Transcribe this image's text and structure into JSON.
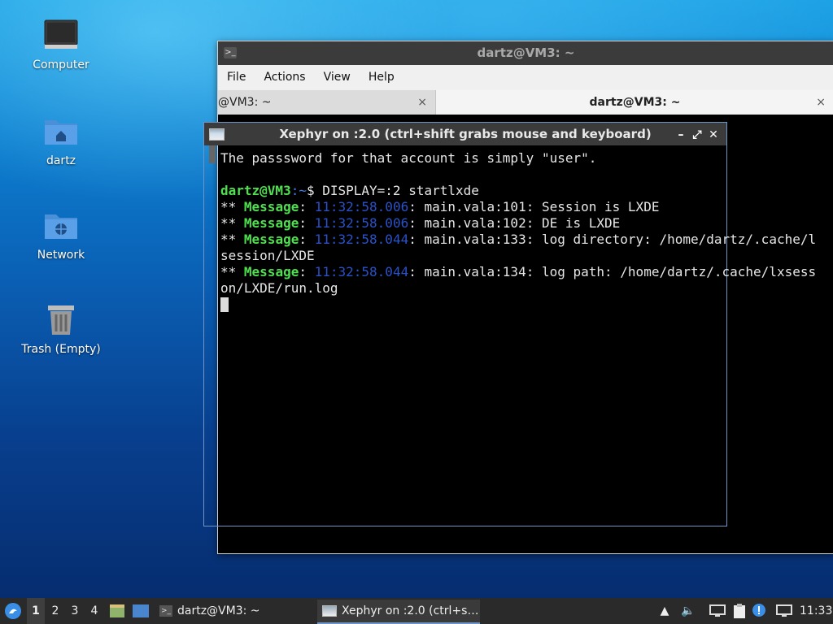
{
  "desktop": {
    "icons": [
      {
        "label": "Computer",
        "icon": "computer-icon"
      },
      {
        "label": "dartz",
        "icon": "home-folder-icon"
      },
      {
        "label": "Network",
        "icon": "network-folder-icon"
      },
      {
        "label": "Trash (Empty)",
        "icon": "trash-icon"
      }
    ]
  },
  "terminal": {
    "title": "dartz@VM3: ~",
    "menu": [
      "File",
      "Actions",
      "View",
      "Help"
    ],
    "tabs": [
      {
        "label": "@VM3: ~",
        "close": "×"
      },
      {
        "label": "dartz@VM3: ~",
        "close": "×"
      }
    ],
    "ghost_line": "The passsword for that account is simply \"user\"."
  },
  "xephyr": {
    "title": "Xephyr on :2.0 (ctrl+shift grabs mouse and keyboard)",
    "buttons": {
      "minimize": "–",
      "maximize": "⤢",
      "close": "✕"
    },
    "lines": [
      {
        "prompt_user": "dartz@VM3",
        "prompt_path": ":~",
        "prompt_sym": "$ ",
        "command": "DISPLAY=:2 startlxde"
      },
      {
        "stars": "** ",
        "tag": "Message",
        "sep": ": ",
        "time": "11:32:58.006",
        "text": ": main.vala:101: Session is LXDE"
      },
      {
        "stars": "** ",
        "tag": "Message",
        "sep": ": ",
        "time": "11:32:58.006",
        "text": ": main.vala:102: DE is LXDE"
      },
      {
        "stars": "** ",
        "tag": "Message",
        "sep": ": ",
        "time": "11:32:58.044",
        "text": ": main.vala:133: log directory: /home/dartz/.cache/l"
      },
      {
        "plain": "session/LXDE"
      },
      {
        "stars": "** ",
        "tag": "Message",
        "sep": ": ",
        "time": "11:32:58.044",
        "text": ": main.vala:134: log path: /home/dartz/.cache/lxsess"
      },
      {
        "plain": "on/LXDE/run.log"
      }
    ]
  },
  "taskbar": {
    "workspaces": [
      "1",
      "2",
      "3",
      "4"
    ],
    "active_workspace": "1",
    "windows": [
      {
        "label": "dartz@VM3: ~",
        "icon": "terminal-icon"
      },
      {
        "label": "Xephyr on :2.0 (ctrl+s…",
        "icon": "xephyr-icon"
      }
    ],
    "clock": "11:33"
  }
}
